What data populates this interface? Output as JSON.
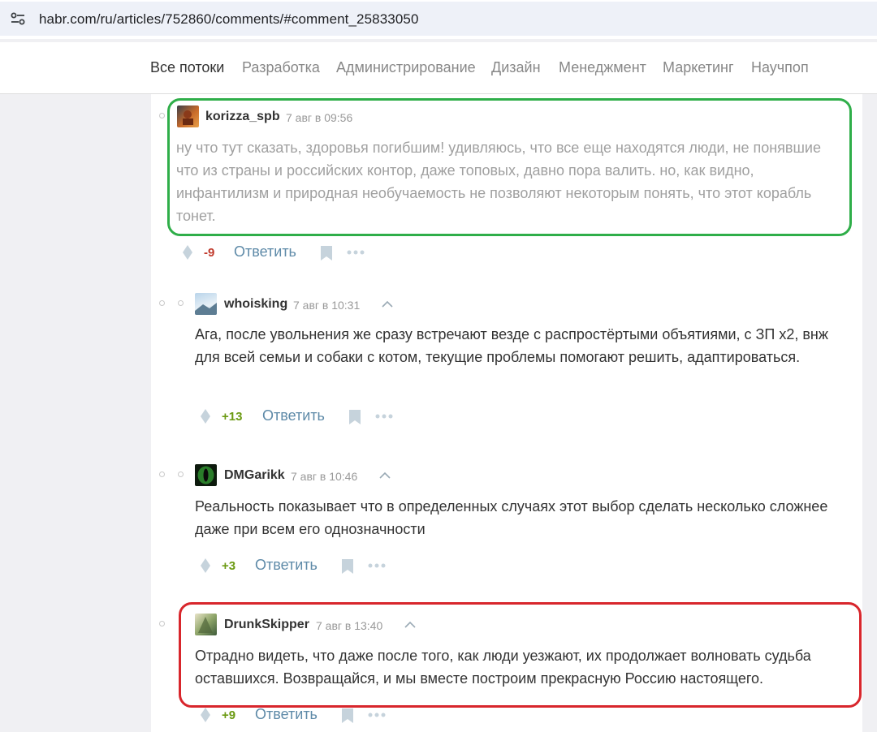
{
  "browser": {
    "url": "habr.com/ru/articles/752860/comments/#comment_25833050",
    "site_settings_icon": "tune-icon"
  },
  "nav": {
    "items": [
      {
        "label": "Все потоки"
      },
      {
        "label": "Разработка"
      },
      {
        "label": "Администрирование"
      },
      {
        "label": "Дизайн"
      },
      {
        "label": "Менеджмент"
      },
      {
        "label": "Маркетинг"
      },
      {
        "label": "Научпоп"
      }
    ]
  },
  "comments": [
    {
      "author": "korizza_spb",
      "time": "7 авг в 09:56",
      "text": "ну что тут сказать, здоровья погибшим! удивляюсь, что все еще находятся люди, не понявшие что из страны и российских контор, даже топовых, давно пора валить. но, как видно, инфантилизм и природная необучаемость не позволяют некоторым понять, что этот корабль тонет.",
      "score": "-9",
      "reply_label": "Ответить"
    },
    {
      "author": "whoisking",
      "time": "7 авг в 10:31",
      "text": "Ага, после увольнения же сразу встречают везде с распростёртыми объятиями, с ЗП x2, внж для всей семьи и собаки с котом, текущие проблемы помогают решить, адаптироваться.",
      "score": "+13",
      "reply_label": "Ответить"
    },
    {
      "author": "DMGarikk",
      "time": "7 авг в 10:46",
      "text": "Реальность показывает что в определенных случаях этот выбор сделать несколько сложнее даже при всем его однозначности",
      "score": "+3",
      "reply_label": "Ответить"
    },
    {
      "author": "DrunkSkipper",
      "time": "7 авг в 13:40",
      "text": "Отрадно видеть, что даже после того, как люди уезжают, их продолжает волновать судьба оставшихся. Возвращайся, и мы вместе построим прекрасную Россию настоящего.",
      "score": "+9",
      "reply_label": "Ответить"
    }
  ],
  "colors": {
    "highlight_green": "#2fae49",
    "highlight_red": "#d8262c",
    "score_negative": "#c0392b",
    "score_positive": "#6b9a12",
    "reply_link": "#5e8aa8"
  }
}
